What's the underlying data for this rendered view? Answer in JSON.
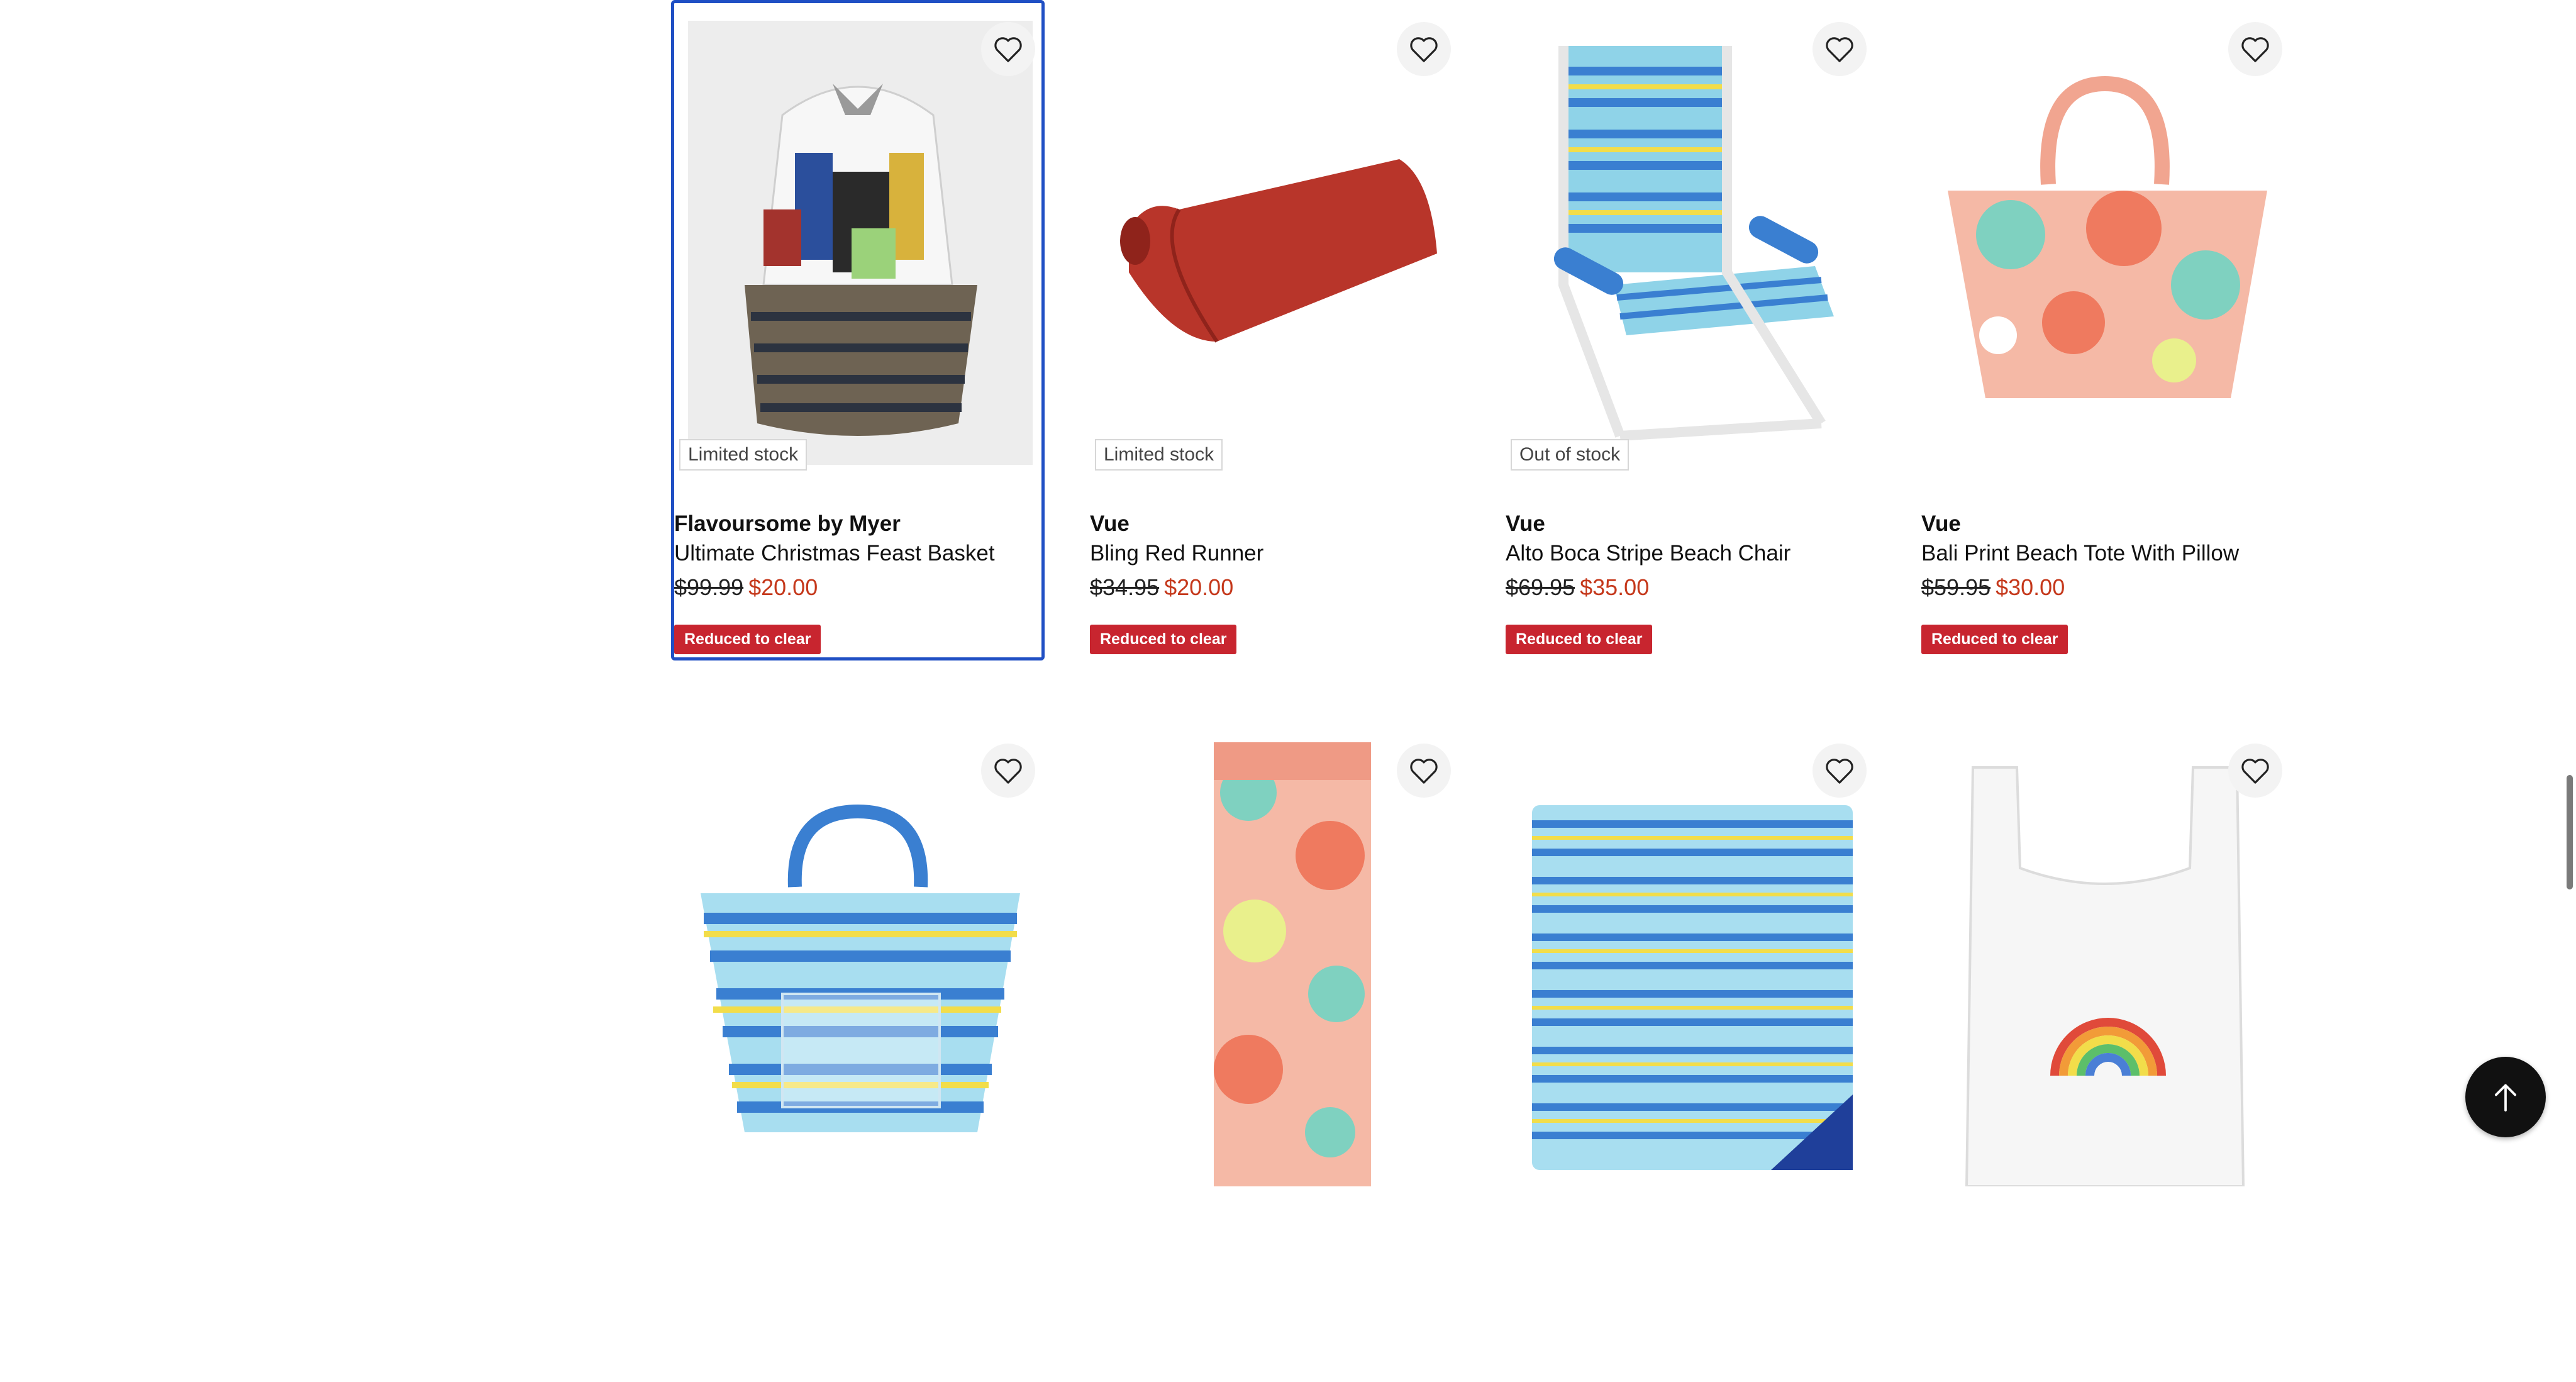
{
  "products": [
    {
      "brand": "Flavoursome by Myer",
      "name": "Ultimate Christmas Feast Basket",
      "was_price": "$99.99",
      "now_price": "$20.00",
      "stock_label": "Limited stock",
      "badge": "Reduced to clear",
      "image_icon": "gift-basket-image"
    },
    {
      "brand": "Vue",
      "name": "Bling Red Runner",
      "was_price": "$34.95",
      "now_price": "$20.00",
      "stock_label": "Limited stock",
      "badge": "Reduced to clear",
      "image_icon": "red-table-runner-image"
    },
    {
      "brand": "Vue",
      "name": "Alto Boca Stripe Beach Chair",
      "was_price": "$69.95",
      "now_price": "$35.00",
      "stock_label": "Out of stock",
      "badge": "Reduced to clear",
      "image_icon": "striped-beach-chair-image"
    },
    {
      "brand": "Vue",
      "name": "Bali Print Beach Tote With Pillow",
      "was_price": "$59.95",
      "now_price": "$30.00",
      "badge": "Reduced to clear",
      "image_icon": "tropical-tote-bag-image"
    },
    {
      "image_icon": "striped-tote-bag-image"
    },
    {
      "image_icon": "tropical-beach-mat-image"
    },
    {
      "image_icon": "striped-picnic-blanket-image"
    },
    {
      "image_icon": "rainbow-shopping-bag-image"
    }
  ],
  "icons": {
    "wishlist": "heart-outline-icon",
    "back_to_top": "arrow-up-icon"
  },
  "colors": {
    "focus_outline": "#1f4fc4",
    "sale_price": "#c5381b",
    "badge_bg": "#c8252f",
    "back_to_top_bg": "#111111"
  }
}
